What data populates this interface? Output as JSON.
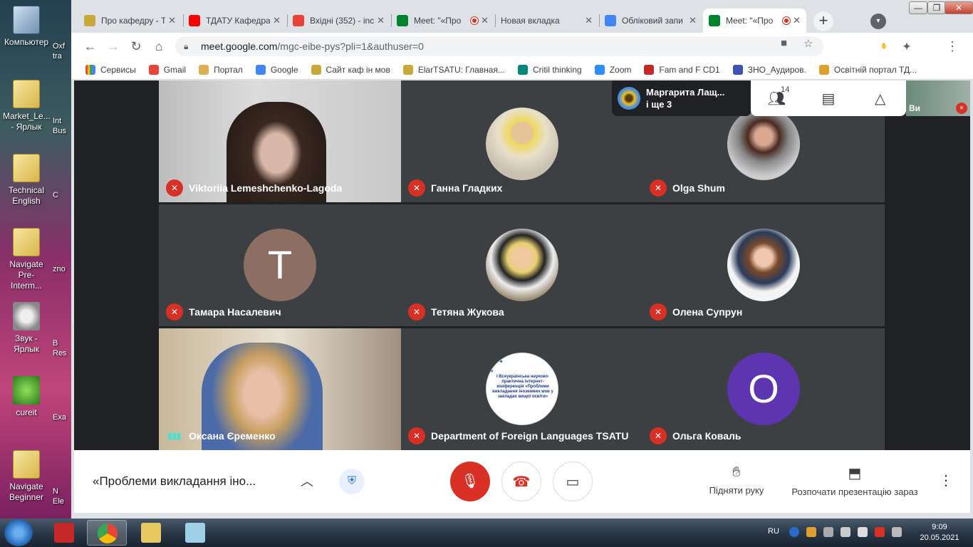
{
  "desktop": {
    "icons": [
      {
        "label": "Компьютер"
      },
      {
        "label": "Market_Le... - Ярлык"
      },
      {
        "label": "Technical English"
      },
      {
        "label": "Navigate Pre-Interm..."
      },
      {
        "label": "Звук - Ярлык"
      },
      {
        "label": "cureit"
      },
      {
        "label": "Navigate Beginner"
      }
    ],
    "strip": [
      "Oxf",
      "tra",
      "Int",
      "Bus",
      "C",
      "zno",
      "B",
      "Res",
      "Exa",
      "N",
      "Ele"
    ]
  },
  "browser": {
    "tabs": [
      {
        "title": "Про кафедру - Т",
        "color": "#c9a93a"
      },
      {
        "title": "ТДАТУ Кафедра",
        "color": "#ff0000"
      },
      {
        "title": "Вхідні (352) - inc",
        "color": "#ea4335"
      },
      {
        "title": "Meet: \"«Про",
        "color": "#00832d"
      },
      {
        "title": "Новая вкладка",
        "color": "#ffffff"
      },
      {
        "title": "Обліковий запи",
        "color": "#4285f4"
      },
      {
        "title": "Meet: \"«Про",
        "color": "#00832d"
      }
    ],
    "new_tab": "+",
    "window": {
      "minimize": "—",
      "restore": "❐",
      "close": "✕"
    },
    "url_host": "meet.google.com",
    "url_path": "/mgc-eibe-pys?pli=1&authuser=0",
    "extensions": [
      {
        "label": "♛",
        "color": "#c2185b"
      },
      {
        "label": "ABP",
        "color": "#d32f2f"
      },
      {
        "label": "✋",
        "color": "#e53935"
      },
      {
        "label": "✦",
        "color": "#5f6368"
      },
      {
        "label": "◍",
        "color": "#4a7ab0"
      }
    ],
    "bookmarks": [
      {
        "label": "Сервисы",
        "color": "#ea4335"
      },
      {
        "label": "Gmail",
        "color": "#ea4335"
      },
      {
        "label": "Портал",
        "color": "#e0b050"
      },
      {
        "label": "Google",
        "color": "#4285f4"
      },
      {
        "label": "Сайт каф ін мов",
        "color": "#c9a93a"
      },
      {
        "label": "ElarTSATU: Главная...",
        "color": "#c9a93a"
      },
      {
        "label": "Critil thinking",
        "color": "#00897b"
      },
      {
        "label": "Zoom",
        "color": "#2d8cff"
      },
      {
        "label": "Fam and F CD1",
        "color": "#c62828"
      },
      {
        "label": "ЗНО_Аудиров.",
        "color": "#3f51b5"
      },
      {
        "label": "Освітній портал ТД...",
        "color": "#e0a030"
      }
    ]
  },
  "meet": {
    "participants": [
      {
        "name": "Viktoriia Lemeshchenko-Lagoda",
        "type": "video1",
        "muted": true
      },
      {
        "name": "Ганна Гладких",
        "type": "photo-a",
        "muted": true
      },
      {
        "name": "Olga Shum",
        "type": "photo-b",
        "muted": true
      },
      {
        "name": "Тамара Насалевич",
        "type": "letter",
        "letter": "T",
        "color": "#8d6e63",
        "muted": true
      },
      {
        "name": "Тетяна Жукова",
        "type": "photo-c",
        "muted": true
      },
      {
        "name": "Олена Супрун",
        "type": "photo-d",
        "muted": true
      },
      {
        "name": "Оксана Єременко",
        "type": "video2",
        "muted": false
      },
      {
        "name": "Department of Foreign Languages TSATU",
        "type": "logo",
        "muted": true,
        "logo_text": "I Всеукраїнська науково-практична інтернет-конференція «Проблеми викладання іноземних мов у закладах вищої освіти»"
      },
      {
        "name": "Ольга Коваль",
        "type": "letter",
        "letter": "O",
        "color": "#5e35b1",
        "muted": true
      }
    ],
    "presenter_chip": {
      "name": "Маргарита Лащ...",
      "more": "і ще 3"
    },
    "people_count": "14",
    "self_label": "Ви",
    "meeting_title": "«Проблеми викладання іноземних мов у закладах вищої освіти»",
    "raise_hand": "Підняти руку",
    "present_now": "Розпочати презентацію зараз"
  },
  "taskbar": {
    "lang": "RU",
    "time": "9:09",
    "date": "20.05.2021"
  }
}
